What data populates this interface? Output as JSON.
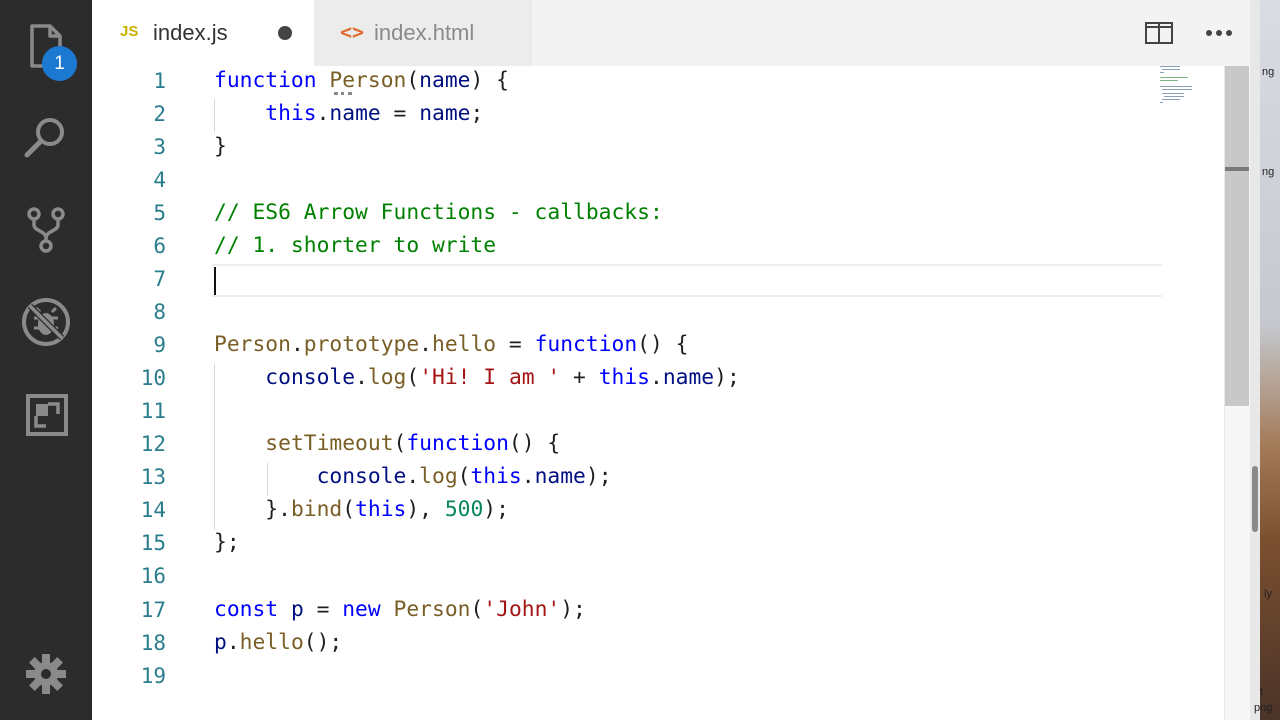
{
  "activity_bar": {
    "icons": [
      "explorer-icon",
      "search-icon",
      "source-control-icon",
      "debug-icon",
      "extensions-icon",
      "settings-gear-icon"
    ],
    "explorer_badge": "1"
  },
  "tabs": [
    {
      "icon": "JS",
      "label": "index.js",
      "active": true,
      "dirty": true
    },
    {
      "icon": "<>",
      "label": "index.html",
      "active": false,
      "dirty": false
    }
  ],
  "tab_actions": [
    "split-editor-icon",
    "more-actions-icon"
  ],
  "editor": {
    "current_line": 7,
    "lines": [
      {
        "n": "1"
      },
      {
        "n": "2"
      },
      {
        "n": "3"
      },
      {
        "n": "4"
      },
      {
        "n": "5"
      },
      {
        "n": "6"
      },
      {
        "n": "7"
      },
      {
        "n": "8"
      },
      {
        "n": "9"
      },
      {
        "n": "10"
      },
      {
        "n": "11"
      },
      {
        "n": "12"
      },
      {
        "n": "13"
      },
      {
        "n": "14"
      },
      {
        "n": "15"
      },
      {
        "n": "16"
      },
      {
        "n": "17"
      },
      {
        "n": "18"
      },
      {
        "n": "19"
      }
    ],
    "tokens": {
      "l1": [
        "function",
        " ",
        "Person",
        "(",
        "name",
        ") {"
      ],
      "l2": [
        "    ",
        "this",
        ".",
        "name",
        " = ",
        "name",
        ";"
      ],
      "l3": [
        "}"
      ],
      "l5": [
        "// ES6 Arrow Functions - callbacks:"
      ],
      "l6": [
        "// 1. shorter to write"
      ],
      "l9": [
        "Person",
        ".",
        "prototype",
        ".",
        "hello",
        " = ",
        "function",
        "() {"
      ],
      "l10": [
        "    ",
        "console",
        ".",
        "log",
        "(",
        "'Hi! I am '",
        " + ",
        "this",
        ".",
        "name",
        ");"
      ],
      "l12": [
        "    ",
        "setTimeout",
        "(",
        "function",
        "() {"
      ],
      "l13": [
        "        ",
        "console",
        ".",
        "log",
        "(",
        "this",
        ".",
        "name",
        ");"
      ],
      "l14": [
        "    }.",
        "bind",
        "(",
        "this",
        "), ",
        "500",
        ");"
      ],
      "l15": [
        "};"
      ],
      "l17": [
        "const",
        " ",
        "p",
        " = ",
        "new",
        " ",
        "Person",
        "(",
        "'John'",
        ");"
      ],
      "l18": [
        "p",
        ".",
        "hello",
        "();"
      ]
    }
  },
  "desktop": {
    "labels": [
      "ng",
      "ng",
      "ly",
      "png",
      "t"
    ]
  },
  "colors": {
    "keyword": "#0000ff",
    "function": "#795e26",
    "variable": "#001080",
    "string": "#a31515",
    "number": "#098658",
    "comment": "#008000",
    "line_number": "#2a7d8c",
    "badge": "#1c79d2"
  }
}
